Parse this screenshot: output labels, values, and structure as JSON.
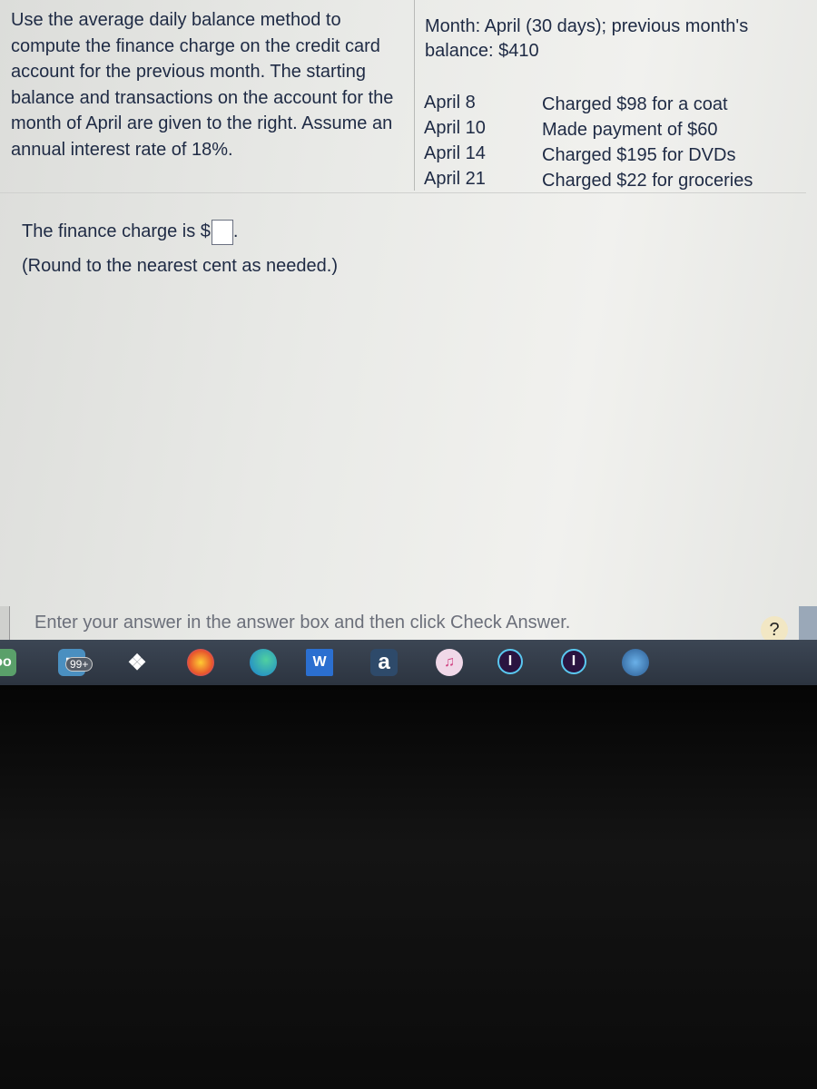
{
  "problem": {
    "instructions": "Use the average daily balance method to compute the finance charge on the credit card account for the previous month. The starting balance and transactions on the account for the month of April are given to the right. Assume an annual interest rate of 18%.",
    "month_info": "Month: April (30 days); previous month's balance: $410",
    "transactions": [
      {
        "date": "April 8",
        "description": "Charged $98 for a coat"
      },
      {
        "date": "April 10",
        "description": "Made payment of $60"
      },
      {
        "date": "April 14",
        "description": "Charged $195 for DVDs"
      },
      {
        "date": "April 21",
        "description": "Charged $22 for groceries"
      }
    ]
  },
  "answer": {
    "prompt": "The finance charge is $",
    "value": "",
    "suffix": ".",
    "note": "(Round to the nearest cent as needed.)"
  },
  "footer": {
    "instruction": "Enter your answer in the answer box and then click Check Answer.",
    "help_label": "?"
  },
  "taskbar": {
    "mail_badge": "99+",
    "apps": [
      "tripadvisor-icon",
      "mail-icon",
      "dropbox-icon",
      "firefox-icon",
      "edge-icon",
      "word-icon",
      "amazon-icon",
      "itunes-icon",
      "app-icon",
      "app-icon",
      "settings-icon"
    ],
    "word_label": "W",
    "amazon_label": "a"
  }
}
